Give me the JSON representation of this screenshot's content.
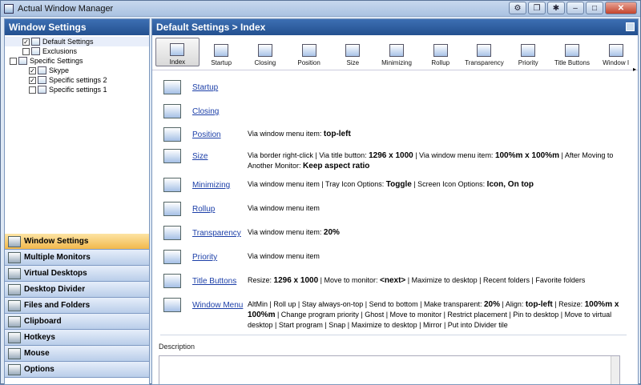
{
  "window": {
    "title": "Actual Window Manager"
  },
  "left": {
    "title": "Window Settings",
    "tree": [
      {
        "label": "Default Settings",
        "checked": true
      },
      {
        "label": "Exclusions",
        "checked": false
      },
      {
        "label": "Specific Settings",
        "checked": false
      },
      {
        "label": "Skype",
        "checked": true
      },
      {
        "label": "Specific settings 2",
        "checked": true
      },
      {
        "label": "Specific settings 1",
        "checked": false
      }
    ],
    "nav": [
      "Window Settings",
      "Multiple Monitors",
      "Virtual Desktops",
      "Desktop Divider",
      "Files and Folders",
      "Clipboard",
      "Hotkeys",
      "Mouse",
      "Options"
    ]
  },
  "right": {
    "breadcrumb": "Default Settings > Index",
    "toolbar": [
      "Index",
      "Startup",
      "Closing",
      "Position",
      "Size",
      "Minimizing",
      "Rollup",
      "Transparency",
      "Priority",
      "Title Buttons",
      "Window I"
    ],
    "rows": [
      {
        "link": "Startup",
        "desc": ""
      },
      {
        "link": "Closing",
        "desc": ""
      },
      {
        "link": "Position",
        "desc_parts": [
          "Via window menu item: ",
          "top-left"
        ]
      },
      {
        "link": "Size",
        "desc_parts": [
          "Via border right-click | Via title button: ",
          "1296 x 1000",
          " | Via window menu item: ",
          "100%m x 100%m",
          " | After Moving to Another Monitor: ",
          "Keep aspect ratio"
        ]
      },
      {
        "link": "Minimizing",
        "desc_parts": [
          "Via window menu item | Tray Icon Options: ",
          "Toggle",
          " | Screen Icon Options: ",
          "Icon, On top"
        ]
      },
      {
        "link": "Rollup",
        "desc_parts": [
          "Via window menu item"
        ]
      },
      {
        "link": "Transparency",
        "desc_parts": [
          "Via window menu item: ",
          "20%"
        ]
      },
      {
        "link": "Priority",
        "desc_parts": [
          "Via window menu item"
        ]
      },
      {
        "link": "Title Buttons",
        "desc_parts": [
          "Resize: ",
          "1296 x 1000",
          " | Move to monitor: ",
          "<next>",
          " | Maximize to desktop | Recent folders | Favorite folders"
        ]
      },
      {
        "link": "Window Menu",
        "desc_parts": [
          "AltMin | Roll up | Stay always-on-top | Send to bottom | Make transparent: ",
          "20%",
          " | Align: ",
          "top-left",
          " | Resize: ",
          "100%m x 100%m",
          " | Change program priority | Ghost | Move to monitor | Restrict placement | Pin to desktop | Move to virtual desktop | Start program | Snap | Maximize to desktop | Mirror | Put into Divider tile"
        ]
      }
    ],
    "description_label": "Description"
  }
}
